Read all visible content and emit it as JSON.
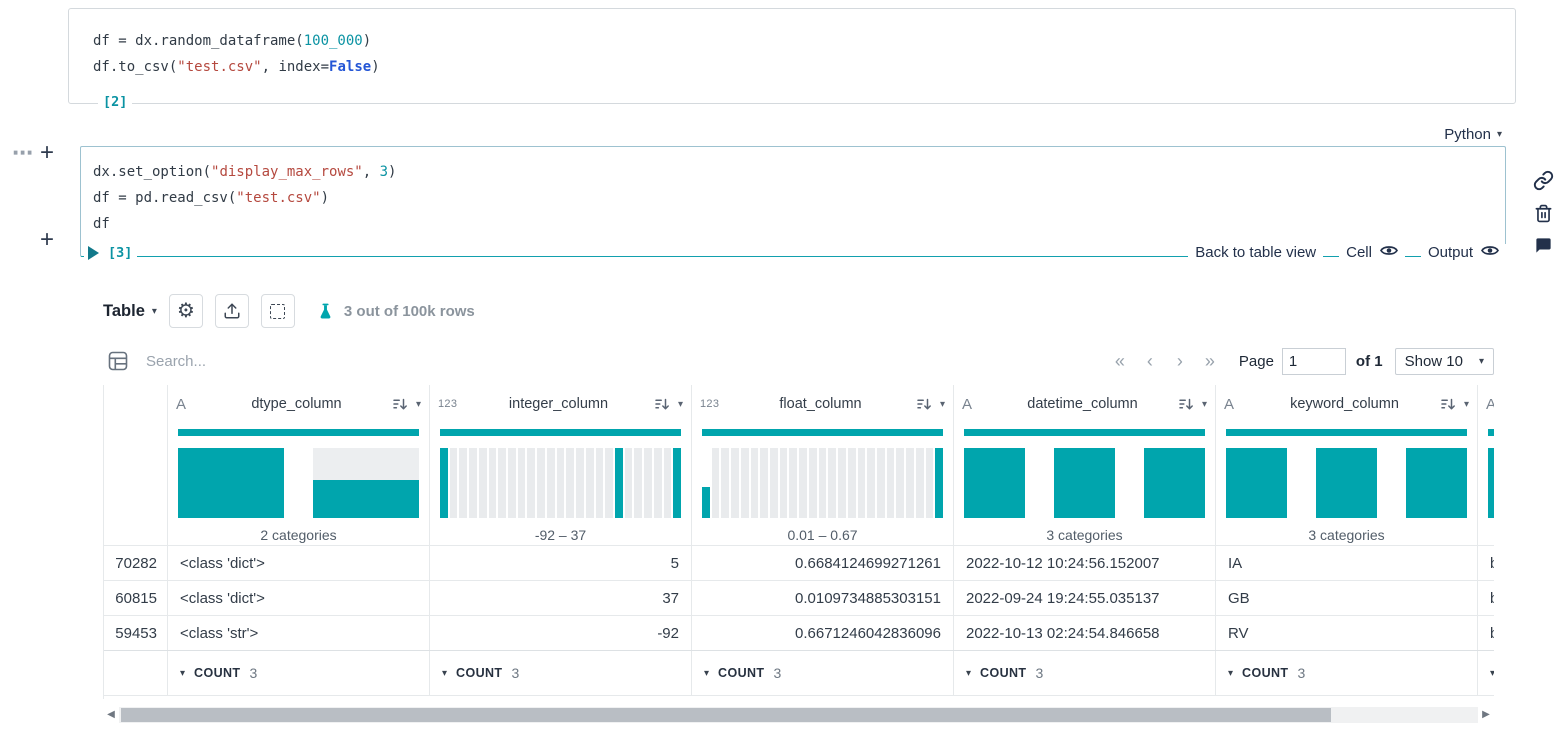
{
  "colors": {
    "accent": "#00a5ad"
  },
  "gutter": {
    "more_label": "⋯",
    "add_above_label": "+",
    "add_below_label": "+"
  },
  "cell1": {
    "exec_label": "[2]",
    "lines": [
      [
        {
          "t": "df = dx.random_dataframe("
        },
        {
          "t": "100_000",
          "c": "num"
        },
        {
          "t": ")"
        }
      ],
      [
        {
          "t": "df.to_csv("
        },
        {
          "t": "\"test.csv\"",
          "c": "str"
        },
        {
          "t": ", index="
        },
        {
          "t": "False",
          "c": "kw"
        },
        {
          "t": ")"
        }
      ]
    ]
  },
  "cell2": {
    "language": "Python",
    "exec_label": "[3]",
    "lines": [
      [
        {
          "t": "dx.set_option("
        },
        {
          "t": "\"display_max_rows\"",
          "c": "str"
        },
        {
          "t": ", "
        },
        {
          "t": "3",
          "c": "num"
        },
        {
          "t": ")"
        }
      ],
      [
        {
          "t": "df = pd.read_csv("
        },
        {
          "t": "\"test.csv\"",
          "c": "str"
        },
        {
          "t": ")"
        }
      ],
      [
        {
          "t": "df"
        }
      ]
    ],
    "back_label": "Back to table view",
    "cell_label": "Cell",
    "output_label": "Output"
  },
  "toolbar": {
    "view_label": "Table",
    "rows_info": "3 out of 100k rows"
  },
  "search_placeholder": "Search...",
  "pagination": {
    "first_label": "«",
    "prev_label": "‹",
    "next_label": "›",
    "last_label": "»",
    "page_label": "Page",
    "page_value": "1",
    "of_label": "of 1",
    "show_value": "Show 10"
  },
  "table": {
    "footer_label": "COUNT",
    "footer_value": "3",
    "columns": [
      {
        "name": "dtype_column",
        "icon": "A",
        "align": "left",
        "summary": "2 categories",
        "hist": {
          "kind": "category",
          "bars": [
            [
              1,
              "t"
            ],
            [
              0.55,
              "t"
            ]
          ]
        }
      },
      {
        "name": "integer_column",
        "icon": "123",
        "align": "right",
        "summary": "-92 – 37",
        "hist": {
          "kind": "numeric",
          "bars": [
            [
              1,
              "t"
            ],
            [
              1,
              "g"
            ],
            [
              1,
              "g"
            ],
            [
              1,
              "g"
            ],
            [
              1,
              "g"
            ],
            [
              1,
              "g"
            ],
            [
              1,
              "g"
            ],
            [
              1,
              "g"
            ],
            [
              1,
              "g"
            ],
            [
              1,
              "g"
            ],
            [
              1,
              "g"
            ],
            [
              1,
              "g"
            ],
            [
              1,
              "g"
            ],
            [
              1,
              "g"
            ],
            [
              1,
              "g"
            ],
            [
              1,
              "g"
            ],
            [
              1,
              "g"
            ],
            [
              1,
              "g"
            ],
            [
              1,
              "t"
            ],
            [
              1,
              "g"
            ],
            [
              1,
              "g"
            ],
            [
              1,
              "g"
            ],
            [
              1,
              "g"
            ],
            [
              1,
              "g"
            ],
            [
              1,
              "t"
            ]
          ]
        }
      },
      {
        "name": "float_column",
        "icon": "123",
        "align": "right",
        "summary": "0.01 – 0.67",
        "hist": {
          "kind": "numeric",
          "bars": [
            [
              0.45,
              "t"
            ],
            [
              1,
              "g"
            ],
            [
              1,
              "g"
            ],
            [
              1,
              "g"
            ],
            [
              1,
              "g"
            ],
            [
              1,
              "g"
            ],
            [
              1,
              "g"
            ],
            [
              1,
              "g"
            ],
            [
              1,
              "g"
            ],
            [
              1,
              "g"
            ],
            [
              1,
              "g"
            ],
            [
              1,
              "g"
            ],
            [
              1,
              "g"
            ],
            [
              1,
              "g"
            ],
            [
              1,
              "g"
            ],
            [
              1,
              "g"
            ],
            [
              1,
              "g"
            ],
            [
              1,
              "g"
            ],
            [
              1,
              "g"
            ],
            [
              1,
              "g"
            ],
            [
              1,
              "g"
            ],
            [
              1,
              "g"
            ],
            [
              1,
              "g"
            ],
            [
              1,
              "g"
            ],
            [
              1,
              "t"
            ]
          ]
        }
      },
      {
        "name": "datetime_column",
        "icon": "A",
        "align": "left",
        "summary": "3 categories",
        "hist": {
          "kind": "category",
          "bars": [
            [
              1,
              "t"
            ],
            [
              1,
              "t"
            ],
            [
              1,
              "t"
            ]
          ]
        }
      },
      {
        "name": "keyword_column",
        "icon": "A",
        "align": "left",
        "summary": "3 categories",
        "hist": {
          "kind": "category",
          "bars": [
            [
              1,
              "t"
            ],
            [
              1,
              "t"
            ],
            [
              1,
              "t"
            ]
          ]
        }
      },
      {
        "name": "",
        "icon": "A",
        "align": "left",
        "summary": "",
        "hist": {
          "kind": "category",
          "bars": [
            [
              1,
              "t"
            ]
          ]
        }
      }
    ],
    "rows": [
      {
        "index": "70282",
        "values": [
          "<class 'dict'>",
          "5",
          "0.6684124699271261",
          "2022-10-12 10:24:56.152007",
          "IA",
          "b'"
        ]
      },
      {
        "index": "60815",
        "values": [
          "<class 'dict'>",
          "37",
          "0.0109734885303151",
          "2022-09-24 19:24:55.035137",
          "GB",
          "b'"
        ]
      },
      {
        "index": "59453",
        "values": [
          "<class 'str'>",
          "-92",
          "0.6671246042836096",
          "2022-10-13 02:24:54.846658",
          "RV",
          "b'"
        ]
      }
    ]
  }
}
